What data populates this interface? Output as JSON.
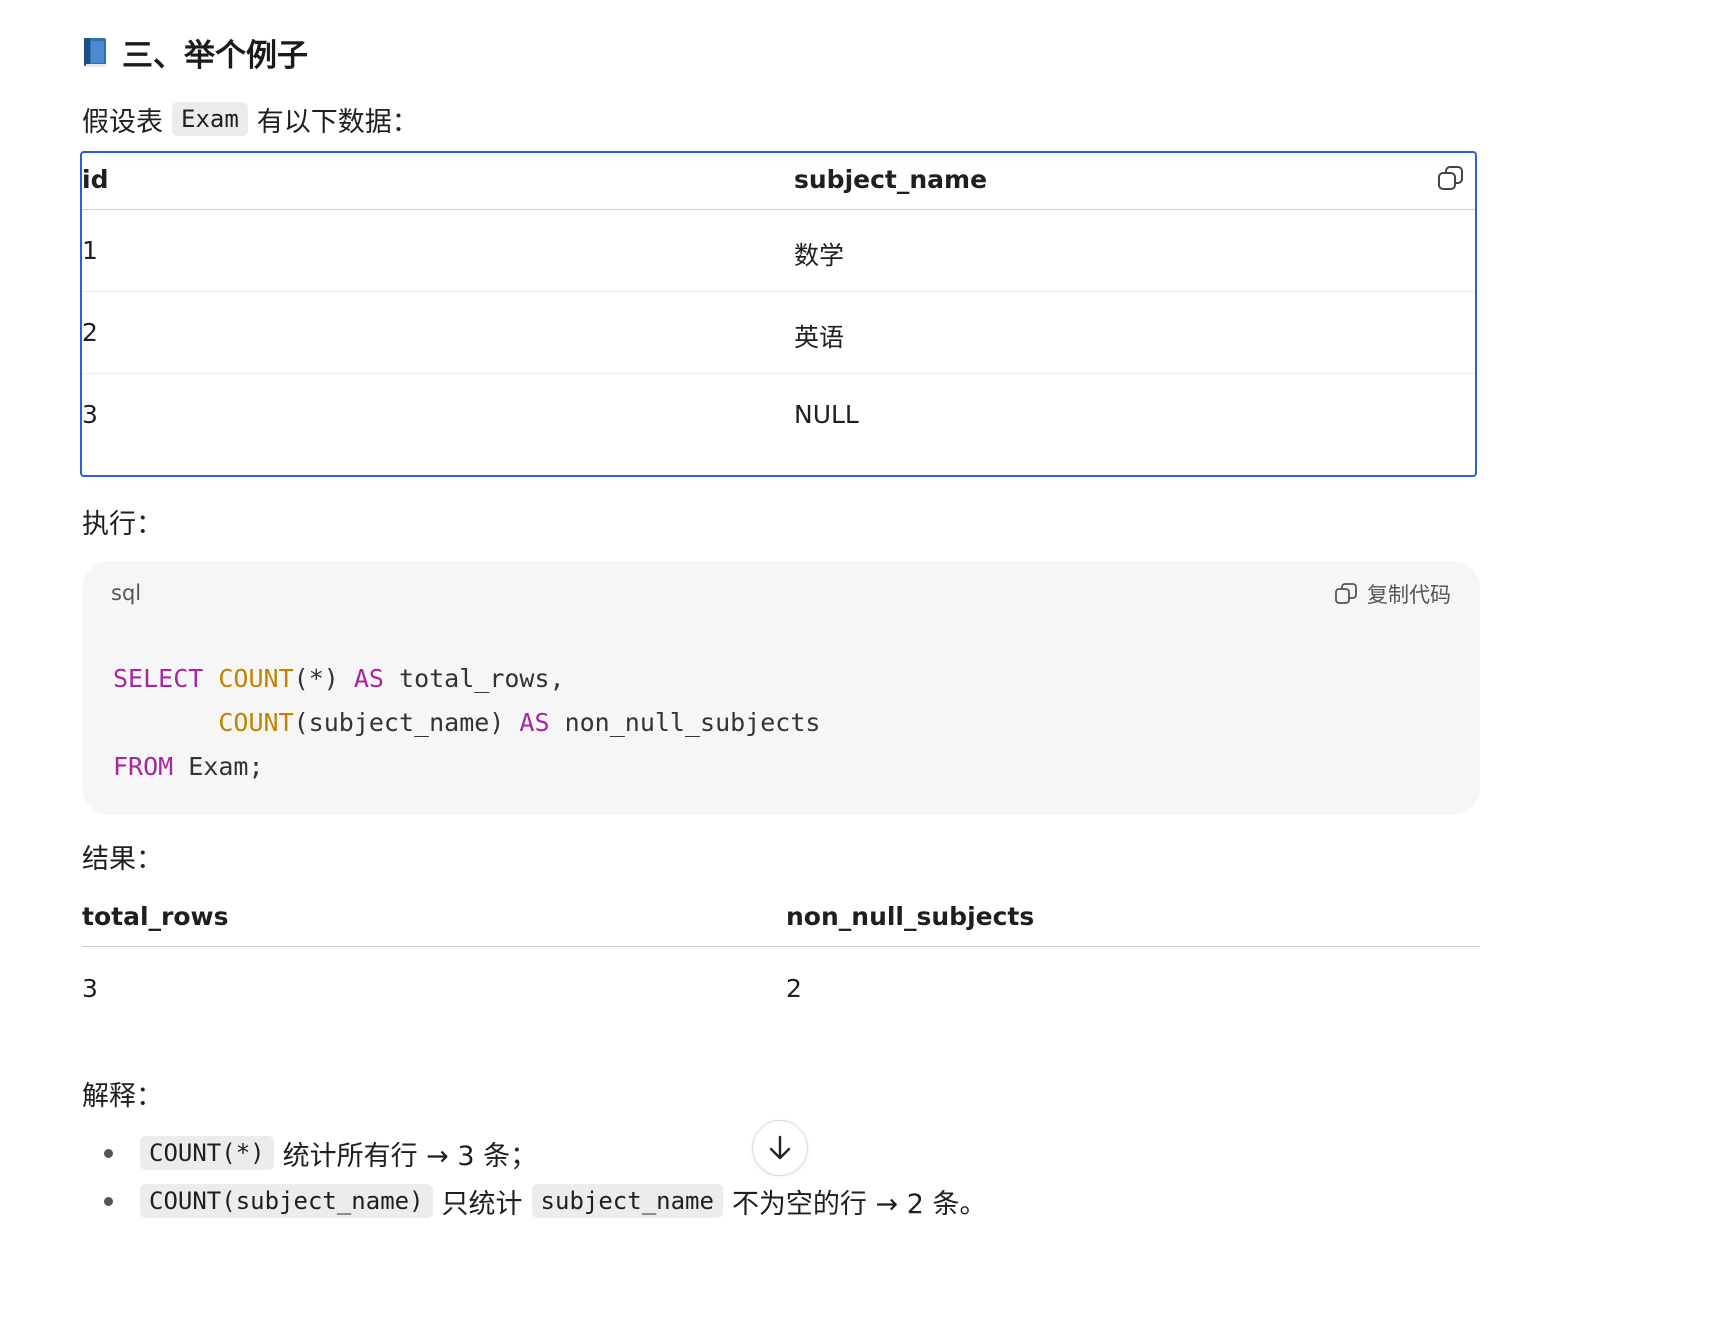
{
  "heading": {
    "icon": "book-icon",
    "text": "三、举个例子"
  },
  "intro": {
    "before": "假设表",
    "code": "Exam",
    "after": "有以下数据："
  },
  "table1": {
    "headers": [
      "id",
      "subject_name"
    ],
    "rows": [
      [
        "1",
        "数学"
      ],
      [
        "2",
        "英语"
      ],
      [
        "3",
        "NULL"
      ]
    ],
    "copy_icon": "copy-icon"
  },
  "exec_label": "执行：",
  "codeblock": {
    "language": "sql",
    "copy_label": "复制代码",
    "lines": [
      [
        {
          "t": "SELECT",
          "c": "kw"
        },
        {
          "t": " ",
          "c": ""
        },
        {
          "t": "COUNT",
          "c": "fn"
        },
        {
          "t": "(*) ",
          "c": ""
        },
        {
          "t": "AS",
          "c": "kw"
        },
        {
          "t": " total_rows,",
          "c": ""
        }
      ],
      [
        {
          "t": "       ",
          "c": ""
        },
        {
          "t": "COUNT",
          "c": "fn"
        },
        {
          "t": "(subject_name) ",
          "c": ""
        },
        {
          "t": "AS",
          "c": "kw"
        },
        {
          "t": " non_null_subjects",
          "c": ""
        }
      ],
      [
        {
          "t": "FROM",
          "c": "kw"
        },
        {
          "t": " Exam;",
          "c": ""
        }
      ]
    ]
  },
  "result_label": "结果：",
  "table2": {
    "headers": [
      "total_rows",
      "non_null_subjects"
    ],
    "rows": [
      [
        "3",
        "2"
      ]
    ]
  },
  "explain_label": "解释：",
  "bullets": [
    {
      "code": "COUNT(*)",
      "text": "统计所有行 → 3 条；"
    },
    {
      "code": "COUNT(subject_name)",
      "text_mid": "只统计",
      "code2": "subject_name",
      "text": "不为空的行 → 2 条。"
    }
  ],
  "colors": {
    "selection_border": "#2b5fd9",
    "keyword": "#a626a4",
    "function": "#c18401"
  }
}
